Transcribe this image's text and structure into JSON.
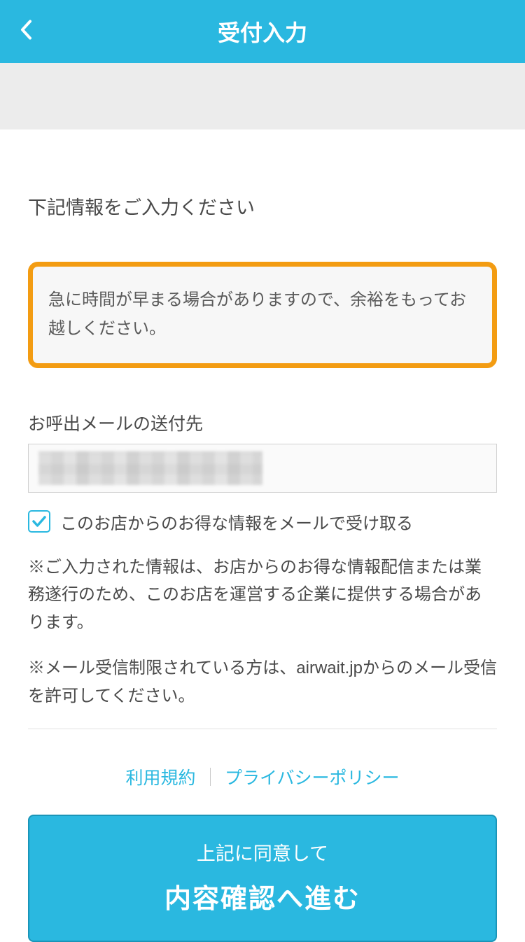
{
  "header": {
    "title": "受付入力"
  },
  "instruction": "下記情報をご入力ください",
  "notice": "急に時間が早まる場合がありますので、余裕をもってお越しください。",
  "emailSection": {
    "label": "お呼出メールの送付先",
    "checkboxLabel": "このお店からのお得な情報をメールで受け取る",
    "checked": true
  },
  "disclaimers": {
    "d1": "※ご入力された情報は、お店からのお得な情報配信または業務遂行のため、このお店を運営する企業に提供する場合があります。",
    "d2": "※メール受信制限されている方は、airwait.jpからのメール受信を許可してください。"
  },
  "links": {
    "terms": "利用規約",
    "privacy": "プライバシーポリシー"
  },
  "submit": {
    "line1": "上記に同意して",
    "line2": "内容確認へ進む"
  }
}
